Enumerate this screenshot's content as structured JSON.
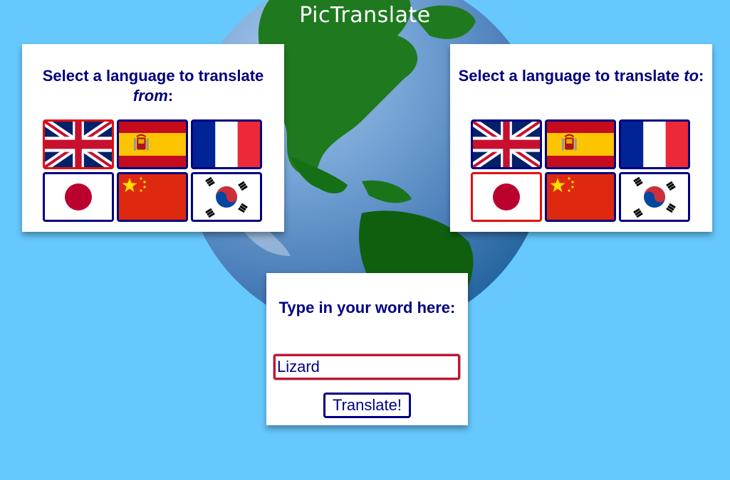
{
  "app": {
    "title": "PicTranslate"
  },
  "from_panel": {
    "heading_prefix": "Select a language to translate ",
    "heading_emphasis": "from",
    "heading_suffix": ":",
    "selected": "english",
    "flags": [
      {
        "id": "english",
        "icon": "uk-flag-icon"
      },
      {
        "id": "spanish",
        "icon": "spain-flag-icon"
      },
      {
        "id": "french",
        "icon": "france-flag-icon"
      },
      {
        "id": "japanese",
        "icon": "japan-flag-icon"
      },
      {
        "id": "chinese",
        "icon": "china-flag-icon"
      },
      {
        "id": "korean",
        "icon": "south-korea-flag-icon"
      }
    ]
  },
  "to_panel": {
    "heading_prefix": "Select a language to translate ",
    "heading_emphasis": "to",
    "heading_suffix": ":",
    "selected": "japanese"
  },
  "word_panel": {
    "heading": "Type in your word here:",
    "input_value": "Lizard",
    "button_label": "Translate!"
  },
  "colors": {
    "background": "#66c8fc",
    "heading": "#000080",
    "flag_border": "#000080",
    "selected_border": "#e01010",
    "input_border": "#c8102e"
  }
}
